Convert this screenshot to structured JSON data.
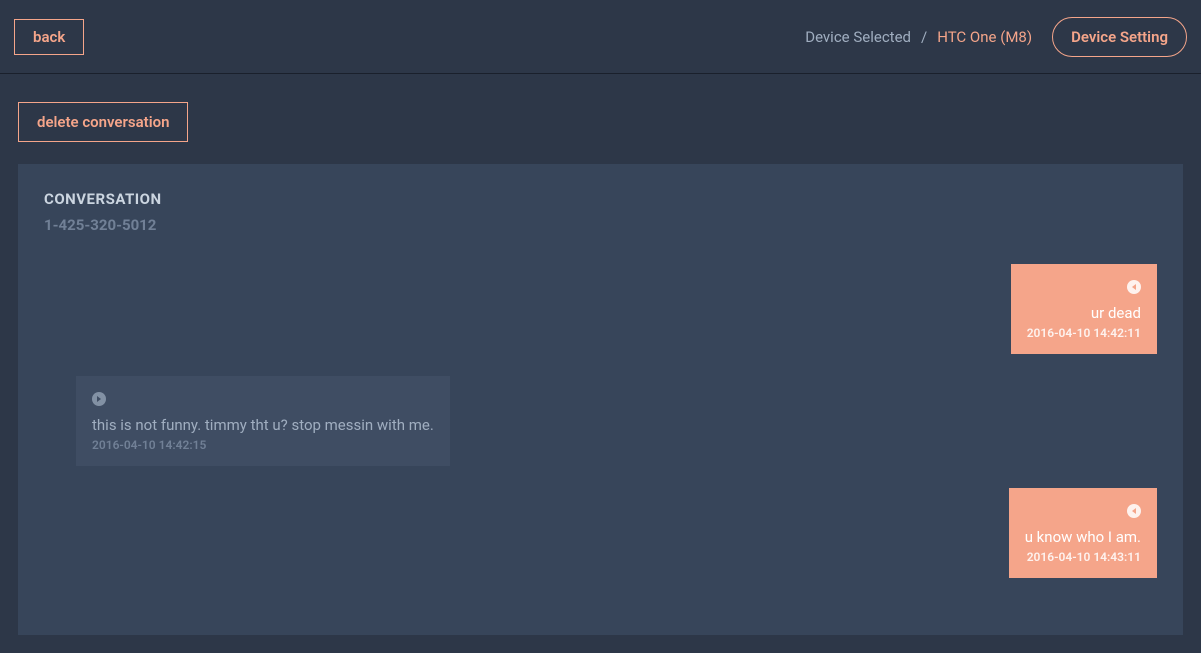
{
  "header": {
    "back_label": "back",
    "device_selected_label": "Device Selected",
    "separator": "/",
    "device_name": "HTC One (M8)",
    "device_setting_label": "Device Setting"
  },
  "actions": {
    "delete_label": "delete conversation"
  },
  "conversation": {
    "title": "CONVERSATION",
    "phone": "1-425-320-5012"
  },
  "messages": [
    {
      "direction": "outgoing",
      "text": "ur dead",
      "time": "2016-04-10 14:42:11"
    },
    {
      "direction": "incoming",
      "text": "this is not funny. timmy tht u? stop messin with me.",
      "time": "2016-04-10 14:42:15"
    },
    {
      "direction": "outgoing",
      "text": "u know who I am.",
      "time": "2016-04-10 14:43:11"
    }
  ]
}
